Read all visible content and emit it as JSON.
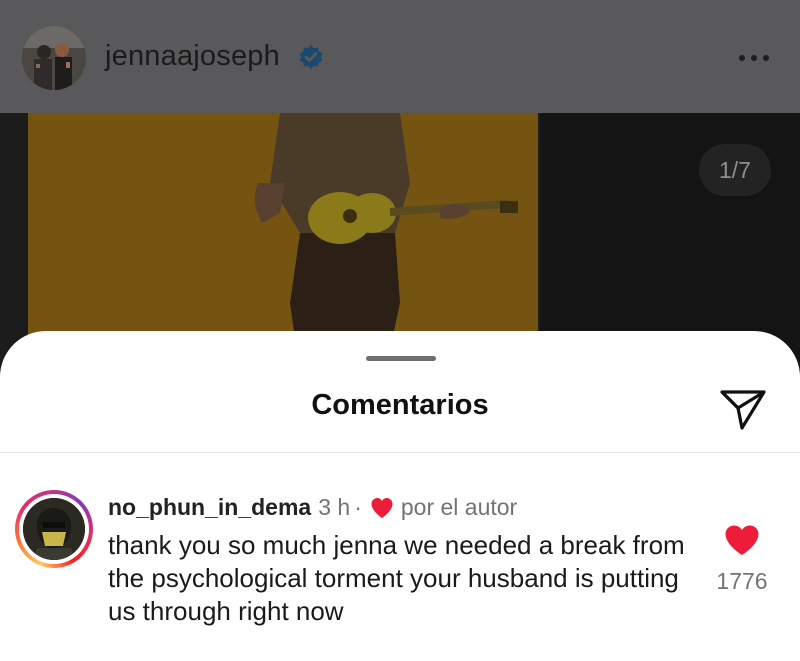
{
  "post": {
    "username": "jennaajoseph",
    "verified_icon": "verified-badge-icon",
    "more_icon": "more-horizontal-icon",
    "carousel_counter": "1/7"
  },
  "comments_sheet": {
    "title": "Comentarios",
    "share_icon": "send-paper-plane-icon"
  },
  "comment": {
    "username": "no_phun_in_dema",
    "time": "3 h",
    "separator": "·",
    "author_like_label": "por el autor",
    "text": "thank you so much jenna we needed a break from the psychological torment your husband is putting us through right now",
    "like_count": "1776",
    "heart_color": "#ed1c3a"
  }
}
